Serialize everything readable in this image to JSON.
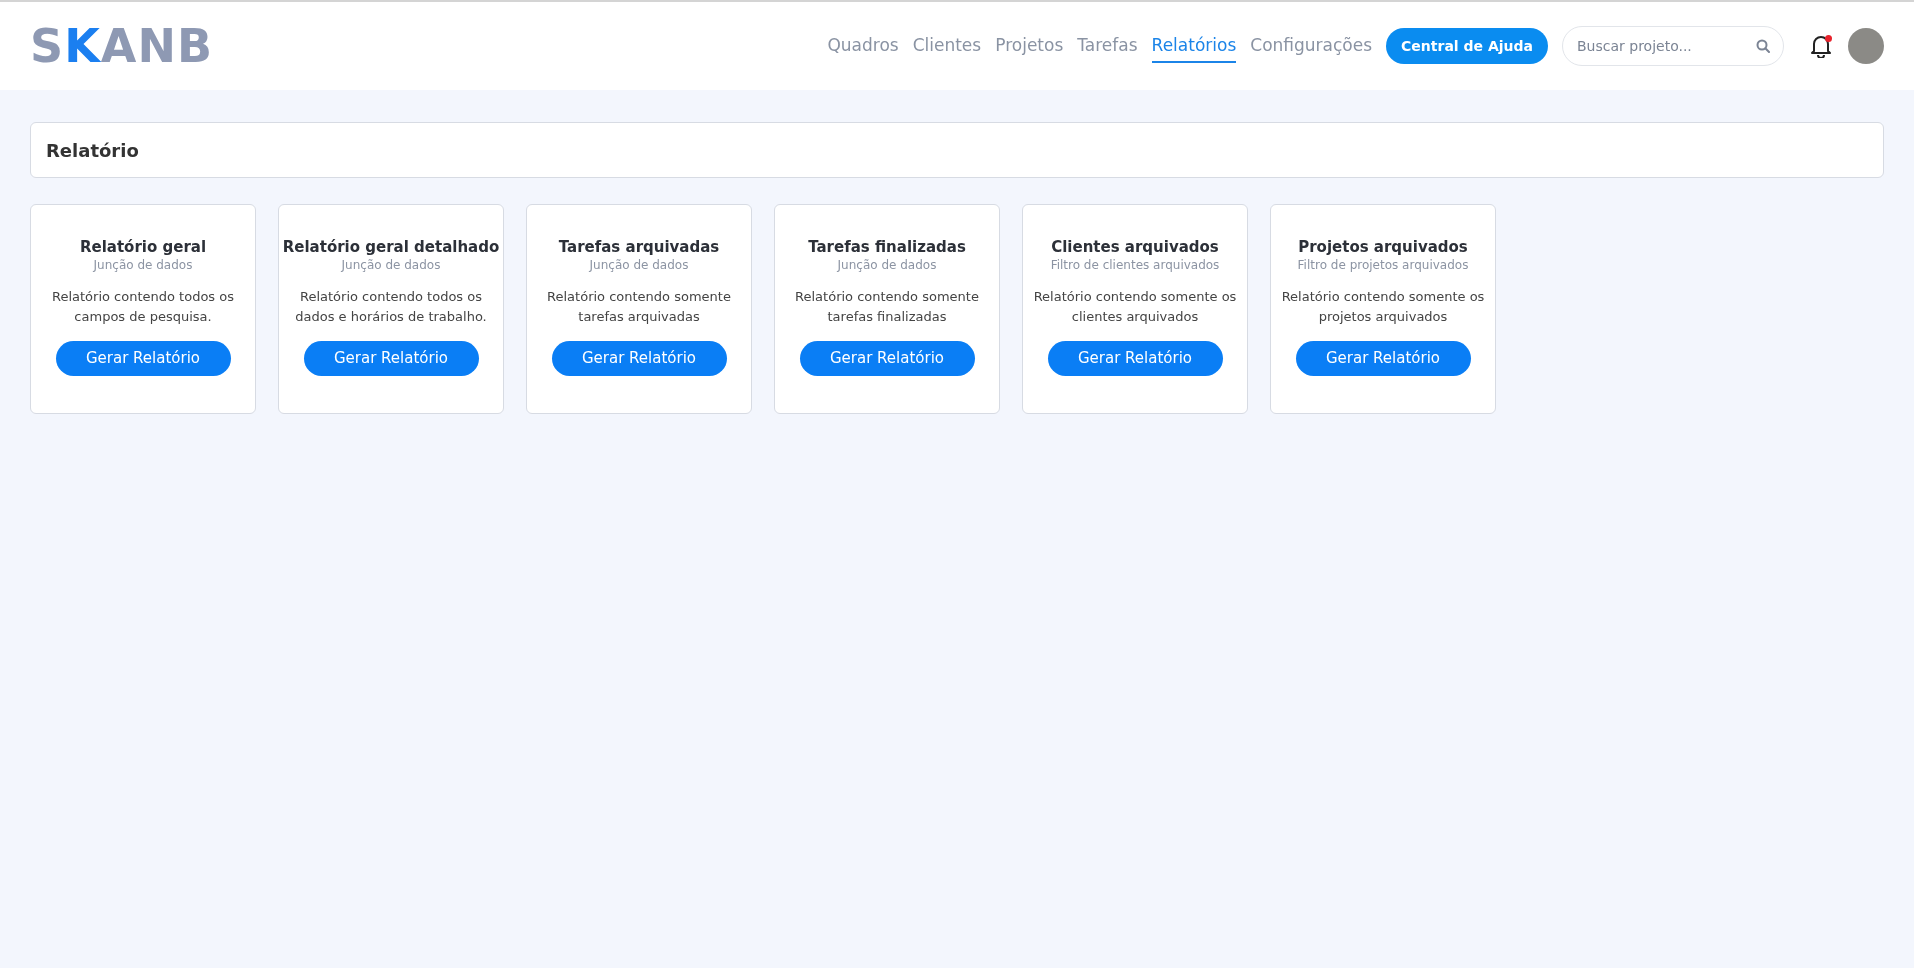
{
  "logo": "SKANB",
  "nav": [
    {
      "label": "Quadros",
      "selected": false
    },
    {
      "label": "Clientes",
      "selected": false
    },
    {
      "label": "Projetos",
      "selected": false
    },
    {
      "label": "Tarefas",
      "selected": false
    },
    {
      "label": "Relatórios",
      "selected": true
    },
    {
      "label": "Configurações",
      "selected": false
    }
  ],
  "help_button": "Central de Ajuda",
  "search": {
    "placeholder": "Buscar projeto..."
  },
  "notifications": {
    "unread": true
  },
  "page_title": "Relatório",
  "cards": [
    {
      "title": "Relatório geral",
      "subtitle": "Junção de dados",
      "description": "Relatório contendo todos os campos de pesquisa.",
      "button": "Gerar Relatório"
    },
    {
      "title": "Relatório geral detalhado",
      "subtitle": "Junção de dados",
      "description": "Relatório contendo todos os dados e horários de trabalho.",
      "button": "Gerar Relatório"
    },
    {
      "title": "Tarefas arquivadas",
      "subtitle": "Junção de dados",
      "description": "Relatório contendo somente tarefas arquivadas",
      "button": "Gerar Relatório"
    },
    {
      "title": "Tarefas finalizadas",
      "subtitle": "Junção de dados",
      "description": "Relatório contendo somente tarefas finalizadas",
      "button": "Gerar Relatório"
    },
    {
      "title": "Clientes arquivados",
      "subtitle": "Filtro de clientes arquivados",
      "description": "Relatório contendo somente os clientes arquivados",
      "button": "Gerar Relatório"
    },
    {
      "title": "Projetos arquivados",
      "subtitle": "Filtro de projetos arquivados",
      "description": "Relatório contendo somente os projetos arquivados",
      "button": "Gerar Relatório"
    }
  ]
}
